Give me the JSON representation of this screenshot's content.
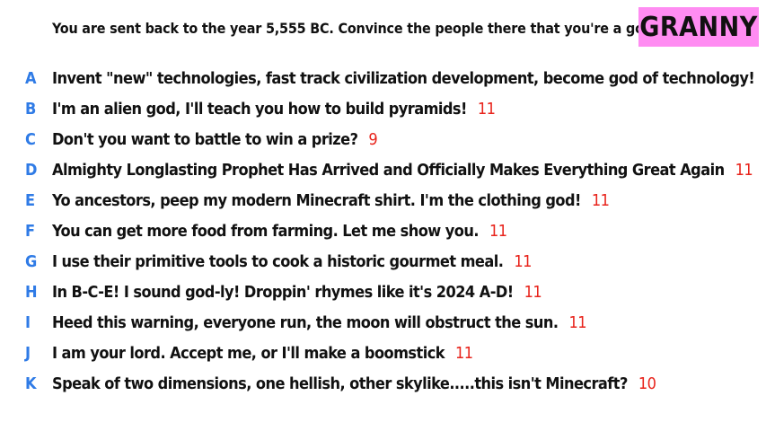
{
  "prompt": "You are sent back to the year 5,555 BC. Convince the people there that you're a god.",
  "badge": "GRANNY",
  "colors": {
    "letter": "#2f7be6",
    "score": "#e8231b",
    "badge_bg": "#ff8cf2"
  },
  "answers": [
    {
      "letter": "A",
      "text": "Invent \"new\" technologies, fast track civilization development, become god of technology!",
      "score": "11"
    },
    {
      "letter": "B",
      "text": "I'm an alien god, I'll teach you how to build pyramids!",
      "score": "11"
    },
    {
      "letter": "C",
      "text": "Don't you want to battle to win a prize?",
      "score": "9"
    },
    {
      "letter": "D",
      "text": "Almighty Longlasting Prophet Has Arrived and Officially Makes Everything Great Again",
      "score": "11"
    },
    {
      "letter": "E",
      "text": "Yo ancestors, peep my modern Minecraft shirt. I'm the clothing god!",
      "score": "11"
    },
    {
      "letter": "F",
      "text": "You can get more food from farming. Let me show you.",
      "score": "11"
    },
    {
      "letter": "G",
      "text": "I use their primitive tools to cook a historic gourmet meal.",
      "score": "11"
    },
    {
      "letter": "H",
      "text": "In B-C-E!  I sound god-ly!  Droppin' rhymes like it's 2024 A-D!",
      "score": "11"
    },
    {
      "letter": "I",
      "text": "Heed this warning, everyone run, the moon will obstruct the sun.",
      "score": "11"
    },
    {
      "letter": "J",
      "text": "I am your lord. Accept me, or I'll make a boomstick",
      "score": "11"
    },
    {
      "letter": "K",
      "text": "Speak of two dimensions, one hellish, other skylike.....this isn't Minecraft?",
      "score": "10"
    }
  ]
}
